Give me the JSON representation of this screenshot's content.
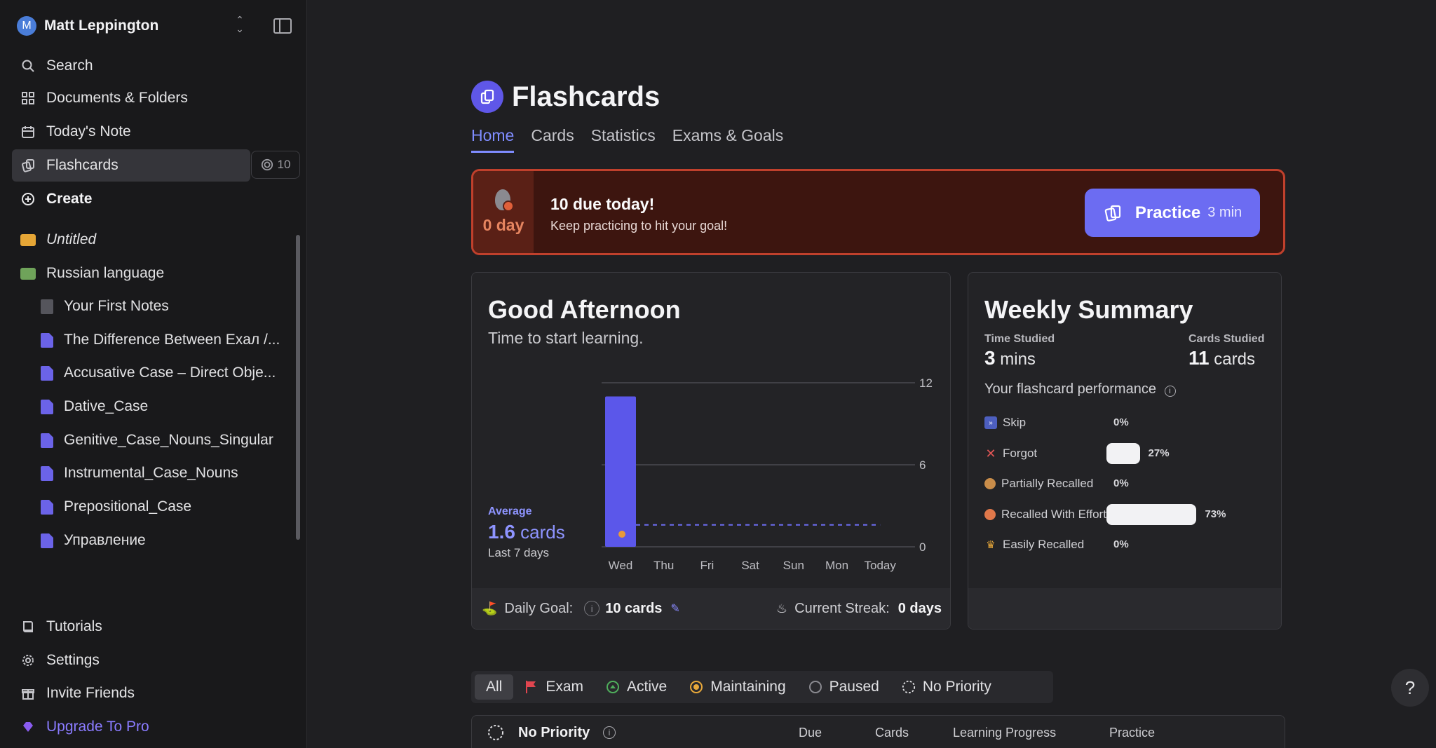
{
  "sidebar": {
    "user": {
      "initial": "M",
      "name": "Matt Leppington"
    },
    "nav": [
      {
        "label": "Search",
        "icon": "search-icon"
      },
      {
        "label": "Documents & Folders",
        "icon": "grid-icon"
      },
      {
        "label": "Today's Note",
        "icon": "calendar-icon"
      },
      {
        "label": "Flashcards",
        "icon": "flashcards-icon",
        "active": true,
        "badge": "10"
      },
      {
        "label": "Create",
        "icon": "plus-circle-icon"
      }
    ],
    "tree": [
      {
        "label": "Untitled",
        "type": "folder",
        "color": "#e6a636",
        "italic": true
      },
      {
        "label": "Russian language",
        "type": "folder",
        "color": "#6fa35a"
      },
      {
        "label": "Your First Notes",
        "type": "doc"
      },
      {
        "label": "The Difference Between Exaл /...",
        "type": "pdf"
      },
      {
        "label": "Accusative Case – Direct Obje...",
        "type": "pdf"
      },
      {
        "label": "Dative_Case",
        "type": "pdf"
      },
      {
        "label": "Genitive_Case_Nouns_Singular",
        "type": "pdf"
      },
      {
        "label": "Instrumental_Case_Nouns",
        "type": "pdf"
      },
      {
        "label": "Prepositional_Case",
        "type": "pdf"
      },
      {
        "label": "Управление",
        "type": "pdf"
      }
    ],
    "bottom": [
      {
        "label": "Tutorials",
        "icon": "book-icon"
      },
      {
        "label": "Settings",
        "icon": "gear-icon"
      },
      {
        "label": "Invite Friends",
        "icon": "gift-icon"
      },
      {
        "label": "Upgrade To Pro",
        "icon": "diamond-icon"
      }
    ]
  },
  "page": {
    "title": "Flashcards",
    "tabs": [
      "Home",
      "Cards",
      "Statistics",
      "Exams & Goals"
    ],
    "active_tab": "Home"
  },
  "due_banner": {
    "streak": "0 day",
    "title": "10 due today!",
    "subtitle": "Keep practicing to hit your goal!",
    "practice_label": "Practice",
    "practice_time": "3 min"
  },
  "greeting_card": {
    "title": "Good Afternoon",
    "subtitle": "Time to start learning.",
    "average_label": "Average",
    "average_value": "1.6",
    "average_unit": "cards",
    "average_period": "Last 7 days",
    "daily_goal_label": "Daily Goal:",
    "daily_goal_value": "10 cards",
    "streak_label": "Current Streak:",
    "streak_value": "0 days"
  },
  "chart_data": {
    "type": "bar",
    "categories": [
      "Wed",
      "Thu",
      "Fri",
      "Sat",
      "Sun",
      "Mon",
      "Today"
    ],
    "values": [
      11,
      0,
      0,
      0,
      0,
      0,
      0
    ],
    "yticks": [
      0,
      6,
      12
    ],
    "ylim": [
      0,
      12
    ],
    "average": 1.6,
    "bar_color": "#5b57ea"
  },
  "weekly_summary": {
    "title": "Weekly Summary",
    "time_label": "Time Studied",
    "time_value": "3",
    "time_unit": "mins",
    "cards_label": "Cards Studied",
    "cards_value": "11",
    "cards_unit": "cards",
    "performance_label": "Your flashcard performance",
    "performance": [
      {
        "label": "Skip",
        "pct_label": "0%",
        "pct": 0,
        "icon": "skip-icon"
      },
      {
        "label": "Forgot",
        "pct_label": "27%",
        "pct": 27,
        "icon": "x-icon"
      },
      {
        "label": "Partially Recalled",
        "pct_label": "0%",
        "pct": 0,
        "icon": "face-icon"
      },
      {
        "label": "Recalled With Effort",
        "pct_label": "73%",
        "pct": 73,
        "icon": "face-effort-icon"
      },
      {
        "label": "Easily Recalled",
        "pct_label": "0%",
        "pct": 0,
        "icon": "crown-icon"
      }
    ]
  },
  "filters": [
    {
      "label": "All",
      "active": true,
      "icon": ""
    },
    {
      "label": "Exam",
      "icon": "flag-icon"
    },
    {
      "label": "Active",
      "icon": "active-icon"
    },
    {
      "label": "Maintaining",
      "icon": "maintaining-icon"
    },
    {
      "label": "Paused",
      "icon": "paused-icon"
    },
    {
      "label": "No Priority",
      "icon": "no-priority-icon"
    }
  ],
  "table": {
    "group_label": "No Priority",
    "columns": [
      "Due",
      "Cards",
      "Learning Progress",
      "Practice"
    ]
  },
  "help_label": "?"
}
